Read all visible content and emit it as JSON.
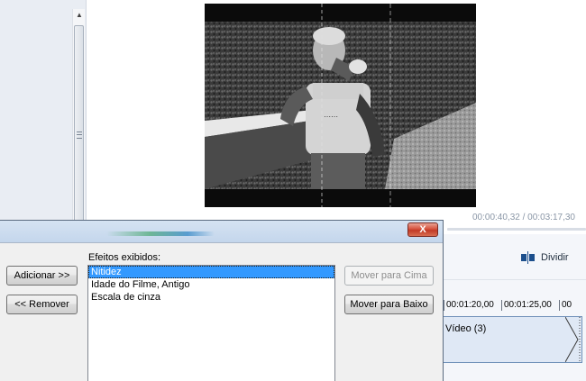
{
  "player": {
    "time_readout": "00:00:40,32 / 00:03:17,30"
  },
  "toolbar": {
    "split_label": "Dividir"
  },
  "timeline": {
    "ruler_marks": [
      "00:01:20,00",
      "00:01:25,00",
      "00"
    ],
    "clip_label": "Vídeo (3)"
  },
  "dialog": {
    "close_label": "X",
    "add_label": "Adicionar >>",
    "remove_label": "<< Remover",
    "displayed_effects_label": "Efeitos exibidos:",
    "effects": [
      {
        "label": "Nitidez",
        "selected": true
      },
      {
        "label": "Idade do Filme, Antigo",
        "selected": false
      },
      {
        "label": "Escala de cinza",
        "selected": false
      }
    ],
    "move_up_label": "Mover para Cima",
    "move_up_enabled": false,
    "move_down_label": "Mover para Baixo",
    "move_down_enabled": true
  },
  "colors": {
    "selection": "#3399ff",
    "close_button": "#c13a26",
    "clip_fill": "#dfe8f5"
  }
}
